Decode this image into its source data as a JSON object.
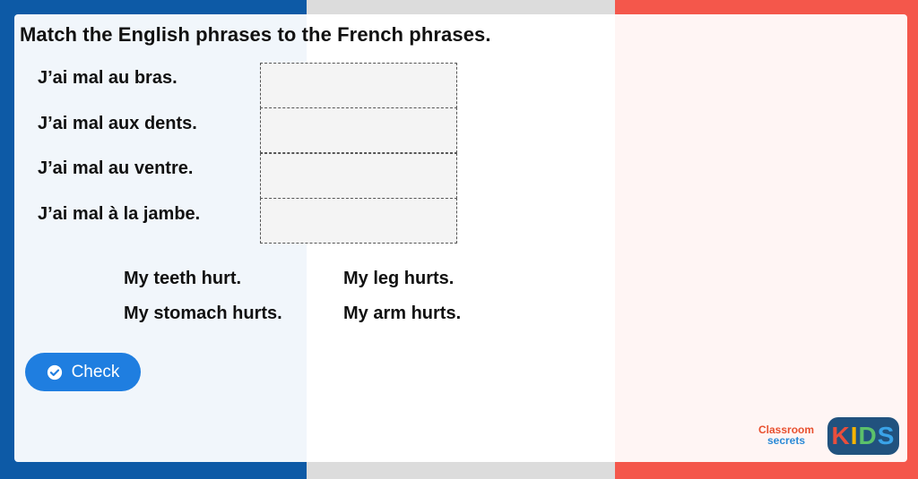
{
  "activity": {
    "title": "Match the English phrases to the French phrases."
  },
  "french_phrases": [
    "J’ai mal au bras.",
    "J’ai mal aux dents.",
    "J’ai mal au ventre.",
    "J’ai mal à la jambe."
  ],
  "english_options": [
    "My teeth hurt.",
    "My leg hurts.",
    "My stomach hurts.",
    "My arm hurts."
  ],
  "check_button": {
    "label": "Check",
    "icon": "check-circle-icon"
  },
  "branding": {
    "classroom_line1": "Classroom",
    "classroom_line2": "secrets",
    "kids_letters": [
      "K",
      "I",
      "D",
      "S"
    ],
    "kids_colors": [
      "#e94e3c",
      "#f5b400",
      "#5cc16a",
      "#3aa3e8"
    ]
  },
  "colors": {
    "flag_blue": "#0d5aa6",
    "flag_white": "#dcdcdc",
    "flag_red": "#f4574b",
    "button": "#1f7ee0"
  }
}
